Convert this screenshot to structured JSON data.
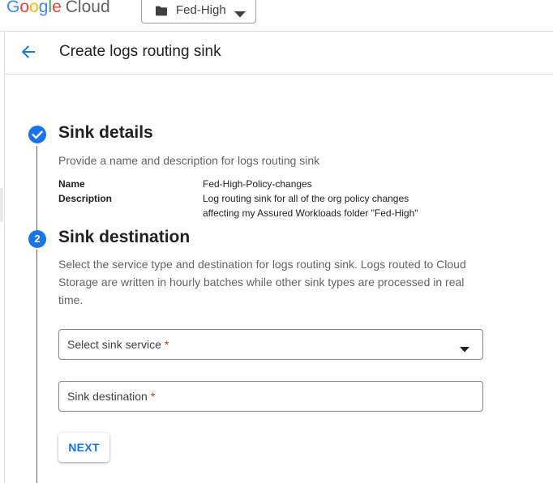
{
  "topbar": {
    "logo_letters": [
      "G",
      "o",
      "o",
      "g",
      "l",
      "e"
    ],
    "logo_cloud": "Cloud",
    "project_name": "Fed-High",
    "icons": [
      "folder-icon",
      "caret-down-icon"
    ]
  },
  "header": {
    "title": "Create logs routing sink",
    "icons": [
      "back-arrow-icon"
    ]
  },
  "steps": {
    "step1": {
      "status": "completed",
      "title": "Sink details",
      "description": "Provide a name and description for logs routing sink",
      "name_label": "Name",
      "name_value": "Fed-High-Policy-changes",
      "description_label": "Description",
      "description_value_line1": "Log routing sink for all of the org policy changes",
      "description_value_line2": "affecting my Assured Workloads folder \"Fed-High\""
    },
    "step2": {
      "number": "2",
      "title": "Sink destination",
      "description_line1": "Select the service type and destination for logs routing sink. Logs routed to Cloud",
      "description_line2": "Storage are written in hourly batches while other sink types are processed in real",
      "description_line3": "time.",
      "service_field": {
        "placeholder": "Select sink service",
        "required_mark": "*"
      },
      "destination_field": {
        "placeholder": "Sink destination",
        "required_mark": "*"
      },
      "next_label": "NEXT"
    }
  },
  "colors": {
    "accent": "#1a73e8",
    "required": "#d93025",
    "text_primary": "#202124",
    "text_secondary": "#5f6368"
  }
}
